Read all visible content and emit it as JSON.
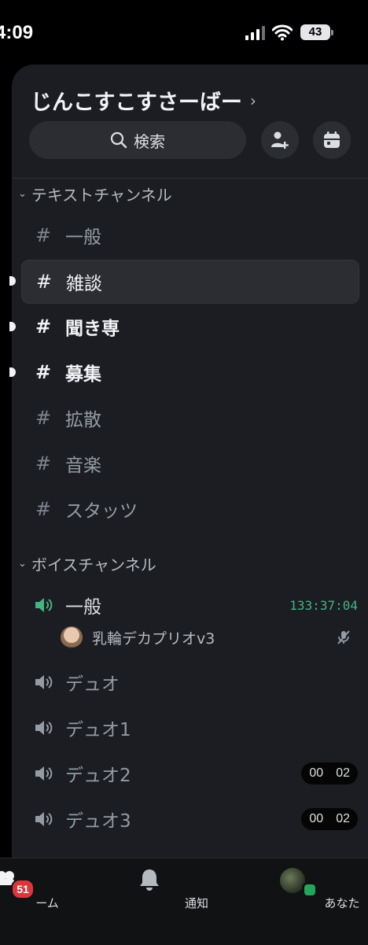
{
  "status_bar": {
    "time": "4:09",
    "battery": "43"
  },
  "server": {
    "name": "じんこすこすさーばー",
    "search_label": "検索"
  },
  "categories": {
    "text": "テキストチャンネル",
    "voice": "ボイスチャンネル"
  },
  "text_channels": [
    {
      "name": "一般",
      "state": "read"
    },
    {
      "name": "雑談",
      "state": "selected"
    },
    {
      "name": "聞き専",
      "state": "unread"
    },
    {
      "name": "募集",
      "state": "unread"
    },
    {
      "name": "拡散",
      "state": "read"
    },
    {
      "name": "音楽",
      "state": "read"
    },
    {
      "name": "スタッツ",
      "state": "read"
    }
  ],
  "voice_channels": [
    {
      "name": "一般",
      "timer": "133:37:04",
      "active": true
    },
    {
      "name": "デュオ"
    },
    {
      "name": "デュオ1"
    },
    {
      "name": "デュオ2",
      "pill": [
        "00",
        "02"
      ]
    },
    {
      "name": "デュオ3",
      "pill": [
        "00",
        "02"
      ]
    }
  ],
  "voice_member": {
    "name": "乳輪デカプリオv3",
    "muted": true
  },
  "tabbar": {
    "home_label": "ーム",
    "home_badge": "51",
    "notifications_label": "通知",
    "you_label": "あなた"
  },
  "colors": {
    "accent_green": "#43b581",
    "badge_red": "#da373c",
    "online": "#23a55a"
  }
}
